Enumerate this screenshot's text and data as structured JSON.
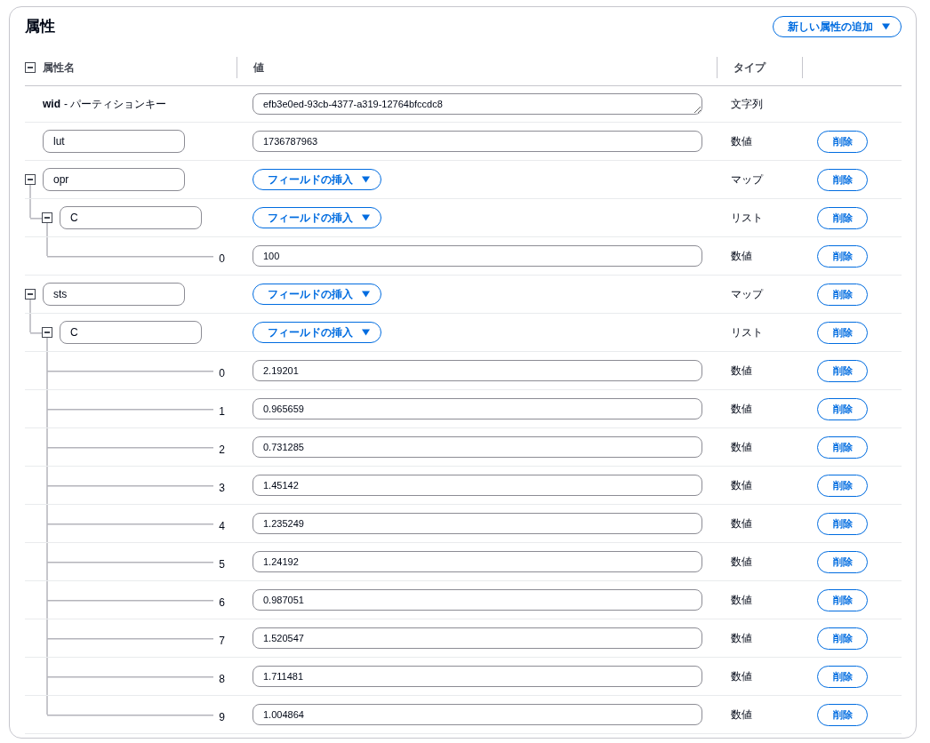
{
  "title": "属性",
  "add_button": {
    "label": "新しい属性の追加"
  },
  "columns": [
    {
      "label": "属性名"
    },
    {
      "label": "値"
    },
    {
      "label": "タイプ"
    }
  ],
  "attributes": [
    {
      "kind": "key",
      "name": "wid",
      "note": "- パーティションキー",
      "value": "efb3e0ed-93cb-4377-a319-12764bfccdc8",
      "type": "文字列"
    },
    {
      "kind": "scalar",
      "name": "lut",
      "value": "1736787963",
      "type": "数値",
      "delete": "削除"
    },
    {
      "kind": "map",
      "name": "opr",
      "expanded": true,
      "insert": "フィールドの挿入",
      "type": "マップ",
      "delete": "削除",
      "children": [
        {
          "kind": "list",
          "name": "C",
          "expanded": true,
          "insert": "フィールドの挿入",
          "type": "リスト",
          "delete": "削除",
          "children": [
            {
              "kind": "element",
              "name": "0",
              "value": "100",
              "type": "数値",
              "delete": "削除"
            }
          ]
        }
      ]
    },
    {
      "kind": "map",
      "name": "sts",
      "expanded": true,
      "insert": "フィールドの挿入",
      "type": "マップ",
      "delete": "削除",
      "children": [
        {
          "kind": "list",
          "name": "C",
          "expanded": true,
          "insert": "フィールドの挿入",
          "type": "リスト",
          "delete": "削除",
          "children": [
            {
              "kind": "element",
              "name": "0",
              "value": "2.19201",
              "type": "数値",
              "delete": "削除"
            },
            {
              "kind": "element",
              "name": "1",
              "value": "0.965659",
              "type": "数値",
              "delete": "削除"
            },
            {
              "kind": "element",
              "name": "2",
              "value": "0.731285",
              "type": "数値",
              "delete": "削除"
            },
            {
              "kind": "element",
              "name": "3",
              "value": "1.45142",
              "type": "数値",
              "delete": "削除"
            },
            {
              "kind": "element",
              "name": "4",
              "value": "1.235249",
              "type": "数値",
              "delete": "削除"
            },
            {
              "kind": "element",
              "name": "5",
              "value": "1.24192",
              "type": "数値",
              "delete": "削除"
            },
            {
              "kind": "element",
              "name": "6",
              "value": "0.987051",
              "type": "数値",
              "delete": "削除"
            },
            {
              "kind": "element",
              "name": "7",
              "value": "1.520547",
              "type": "数値",
              "delete": "削除"
            },
            {
              "kind": "element",
              "name": "8",
              "value": "1.711481",
              "type": "数値",
              "delete": "削除"
            },
            {
              "kind": "element",
              "name": "9",
              "value": "1.004864",
              "type": "数値",
              "delete": "削除"
            }
          ]
        }
      ]
    }
  ]
}
